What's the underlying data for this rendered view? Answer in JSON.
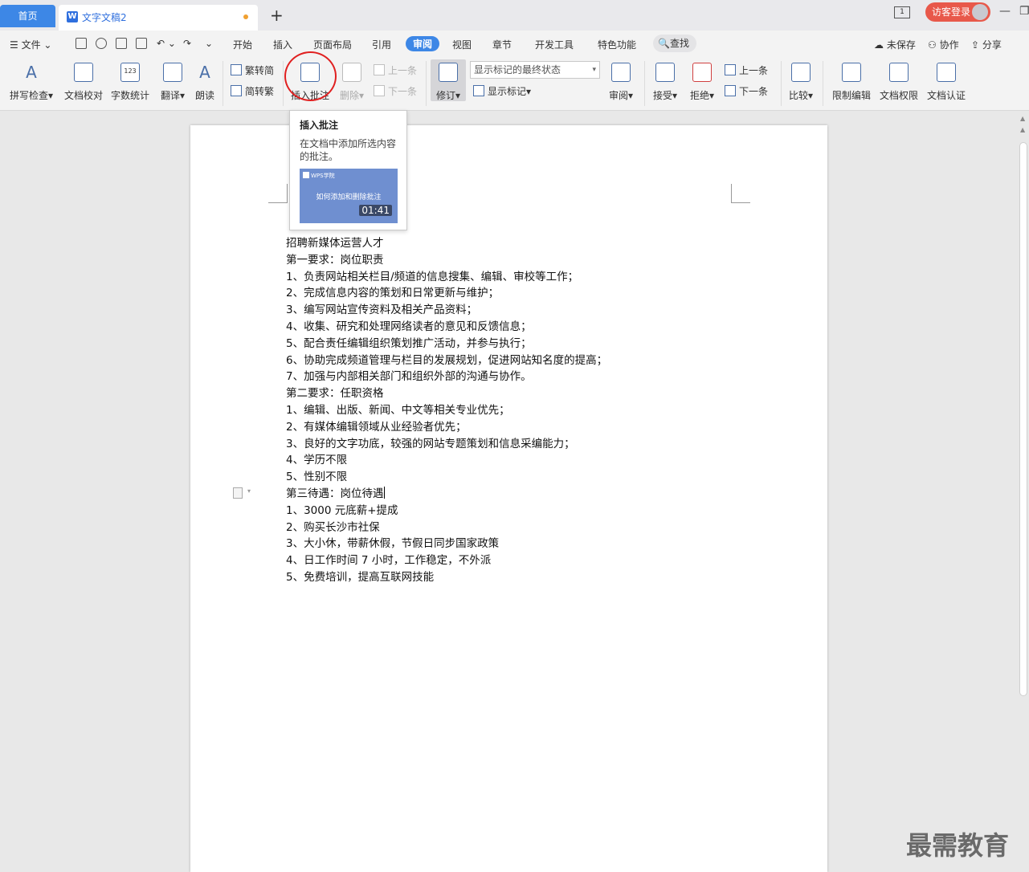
{
  "tabs": {
    "home": "首页",
    "doc": "文字文稿2",
    "add": "+"
  },
  "header": {
    "login": "访客登录",
    "page_indicator": "1"
  },
  "menu": {
    "file": "文件",
    "items": [
      "开始",
      "插入",
      "页面布局",
      "引用",
      "审阅",
      "视图",
      "章节",
      "开发工具",
      "特色功能"
    ],
    "active": "审阅",
    "search": "查找",
    "unsaved": "未保存",
    "collab": "协作",
    "share": "分享"
  },
  "ribbon": {
    "spell_check": "拼写检查",
    "doc_proof": "文档校对",
    "word_count": "字数统计",
    "translate": "翻译",
    "read_aloud": "朗读",
    "trad_to_simp": "繁转简",
    "simp_to_trad": "简转繁",
    "insert_comment": "插入批注",
    "delete": "删除",
    "prev": "上一条",
    "next": "下一条",
    "revise": "修订",
    "markup_state": "显示标记的最终状态",
    "show_markup": "显示标记",
    "review": "审阅",
    "accept": "接受",
    "reject": "拒绝",
    "prev2": "上一条",
    "next2": "下一条",
    "compare": "比较",
    "restrict_edit": "限制编辑",
    "doc_rights": "文档权限",
    "doc_cert": "文档认证"
  },
  "tooltip": {
    "title": "插入批注",
    "desc": "在文档中添加所选内容的批注。",
    "video_logo": "WPS学院",
    "video_title": "如何添加和删除批注",
    "duration": "01:41"
  },
  "document": {
    "lines": [
      "招聘新媒体运营人才",
      "第一要求：岗位职责",
      "1、负责网站相关栏目/频道的信息搜集、编辑、审校等工作；",
      "2、完成信息内容的策划和日常更新与维护；",
      "3、编写网站宣传资料及相关产品资料；",
      "4、收集、研究和处理网络读者的意见和反馈信息；",
      "5、配合责任编辑组织策划推广活动，并参与执行；",
      "6、协助完成频道管理与栏目的发展规划，促进网站知名度的提高；",
      "7、加强与内部相关部门和组织外部的沟通与协作。",
      "第二要求：任职资格",
      "1、编辑、出版、新闻、中文等相关专业优先；",
      "2、有媒体编辑领域从业经验者优先；",
      "3、良好的文字功底，较强的网站专题策划和信息采编能力；",
      "4、学历不限",
      "5、性别不限",
      "第三待遇：岗位待遇",
      "1、3000 元底薪+提成",
      "2、购买长沙市社保",
      "3、大小休，带薪休假，节假日同步国家政策",
      "4、日工作时间 7 小时，工作稳定，不外派",
      "5、免费培训，提高互联网技能"
    ]
  },
  "watermark": "最需教育"
}
